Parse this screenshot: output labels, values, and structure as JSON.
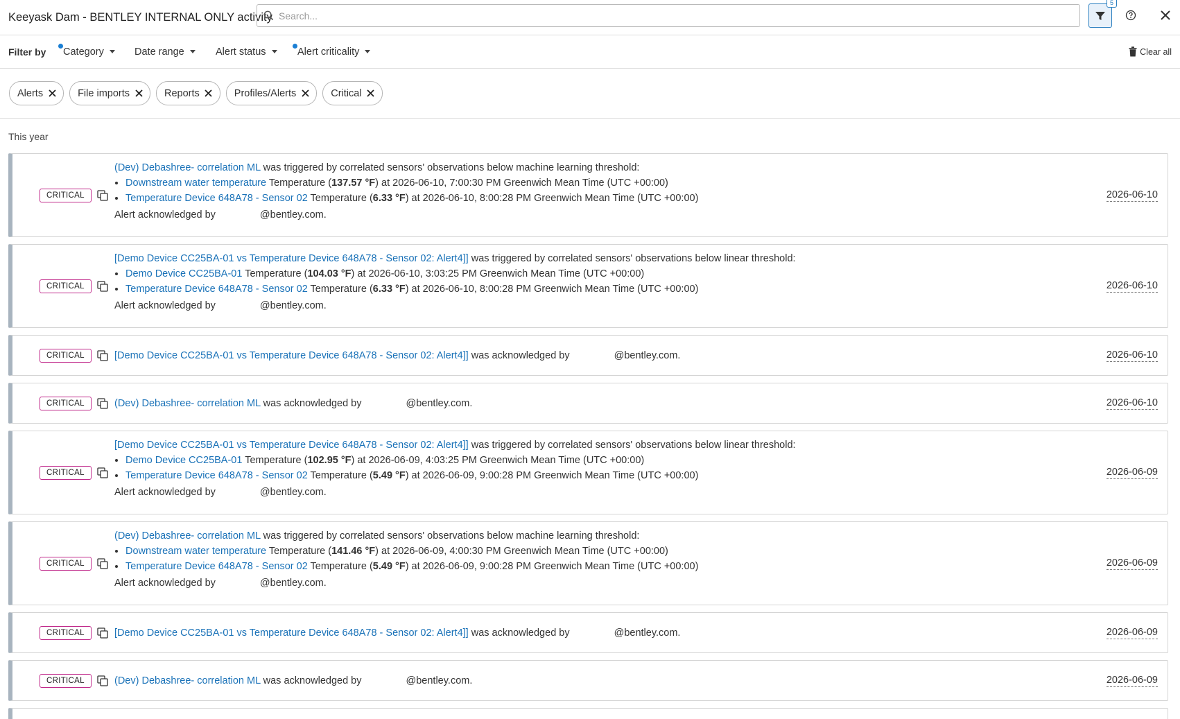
{
  "header": {
    "title": "Keeyask Dam - BENTLEY INTERNAL ONLY activity",
    "search_placeholder": "Search...",
    "filter_count": "5"
  },
  "filterbar": {
    "label": "Filter by",
    "dropdowns": [
      "Category",
      "Date range",
      "Alert status",
      "Alert criticality"
    ],
    "clear_all": "Clear all"
  },
  "chips": [
    "Alerts",
    "File imports",
    "Reports",
    "Profiles/Alerts",
    "Critical"
  ],
  "section": "This year",
  "colors": {
    "link": "#1a72b8",
    "badge_border": "#c0288a",
    "accent": "#2a7fc0"
  },
  "activities": [
    {
      "badge": "CRITICAL",
      "title_link": "(Dev) Debashree- correlation ML",
      "title_rest": " was triggered by correlated sensors' observations below machine learning threshold:",
      "obs": [
        {
          "sensor": "Downstream water temperature",
          "pre": " Temperature (",
          "value": "137.57 °F",
          "post": ") at 2026-06-10, 7:00:30 PM Greenwich Mean Time (UTC +00:00)"
        },
        {
          "sensor": "Temperature Device 648A78 - Sensor 02",
          "pre": " Temperature (",
          "value": "6.33 °F",
          "post": ") at 2026-06-10, 8:00:28 PM Greenwich Mean Time (UTC +00:00)"
        }
      ],
      "ack_prefix": "Alert acknowledged by",
      "ack_suffix": "@bentley.com.",
      "date": "2026-06-10"
    },
    {
      "badge": "CRITICAL",
      "title_link": "[Demo Device CC25BA-01 vs Temperature Device 648A78 - Sensor 02: Alert4]]",
      "title_rest": " was triggered by correlated sensors' observations below linear threshold:",
      "obs": [
        {
          "sensor": "Demo Device CC25BA-01",
          "pre": " Temperature (",
          "value": "104.03 °F",
          "post": ") at 2026-06-10, 3:03:25 PM Greenwich Mean Time (UTC +00:00)"
        },
        {
          "sensor": "Temperature Device 648A78 - Sensor 02",
          "pre": " Temperature (",
          "value": "6.33 °F",
          "post": ") at 2026-06-10, 8:00:28 PM Greenwich Mean Time (UTC +00:00)"
        }
      ],
      "ack_prefix": "Alert acknowledged by",
      "ack_suffix": "@bentley.com.",
      "date": "2026-06-10"
    },
    {
      "badge": "CRITICAL",
      "title_link": "[Demo Device CC25BA-01 vs Temperature Device 648A78 - Sensor 02: Alert4]]",
      "title_rest": " was acknowledged by",
      "ack_suffix": "@bentley.com.",
      "date": "2026-06-10"
    },
    {
      "badge": "CRITICAL",
      "title_link": "(Dev) Debashree- correlation ML",
      "title_rest": " was acknowledged by",
      "ack_suffix": "@bentley.com.",
      "date": "2026-06-10"
    },
    {
      "badge": "CRITICAL",
      "title_link": "[Demo Device CC25BA-01 vs Temperature Device 648A78 - Sensor 02: Alert4]]",
      "title_rest": " was triggered by correlated sensors' observations below linear threshold:",
      "obs": [
        {
          "sensor": "Demo Device CC25BA-01",
          "pre": " Temperature (",
          "value": "102.95 °F",
          "post": ") at 2026-06-09, 4:03:25 PM Greenwich Mean Time (UTC +00:00)"
        },
        {
          "sensor": "Temperature Device 648A78 - Sensor 02",
          "pre": " Temperature (",
          "value": "5.49 °F",
          "post": ") at 2026-06-09, 9:00:28 PM Greenwich Mean Time (UTC +00:00)"
        }
      ],
      "ack_prefix": "Alert acknowledged by",
      "ack_suffix": "@bentley.com.",
      "date": "2026-06-09"
    },
    {
      "badge": "CRITICAL",
      "title_link": "(Dev) Debashree- correlation ML",
      "title_rest": " was triggered by correlated sensors' observations below machine learning threshold:",
      "obs": [
        {
          "sensor": "Downstream water temperature",
          "pre": " Temperature (",
          "value": "141.46 °F",
          "post": ") at 2026-06-09, 4:00:30 PM Greenwich Mean Time (UTC +00:00)"
        },
        {
          "sensor": "Temperature Device 648A78 - Sensor 02",
          "pre": " Temperature (",
          "value": "5.49 °F",
          "post": ") at 2026-06-09, 9:00:28 PM Greenwich Mean Time (UTC +00:00)"
        }
      ],
      "ack_prefix": "Alert acknowledged by",
      "ack_suffix": "@bentley.com.",
      "date": "2026-06-09"
    },
    {
      "badge": "CRITICAL",
      "title_link": "[Demo Device CC25BA-01 vs Temperature Device 648A78 - Sensor 02: Alert4]]",
      "title_rest": " was acknowledged by",
      "ack_suffix": "@bentley.com.",
      "date": "2026-06-09"
    },
    {
      "badge": "CRITICAL",
      "title_link": "(Dev) Debashree- correlation ML",
      "title_rest": " was acknowledged by",
      "ack_suffix": "@bentley.com.",
      "date": "2026-06-09"
    }
  ]
}
